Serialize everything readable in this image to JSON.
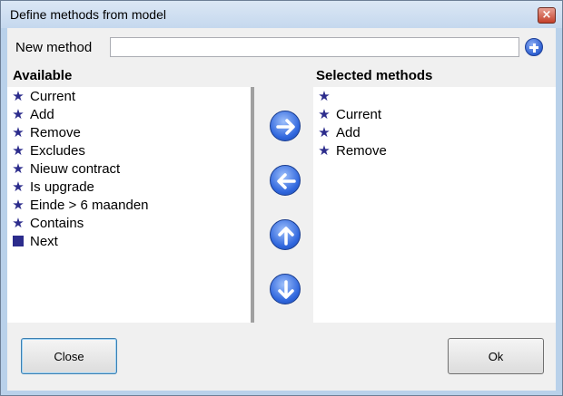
{
  "window": {
    "title": "Define methods from model",
    "close_glyph": "×"
  },
  "new_method": {
    "label": "New method",
    "value": "",
    "placeholder": ""
  },
  "available": {
    "header": "Available",
    "items": [
      {
        "label": "Current",
        "icon": "star-icon"
      },
      {
        "label": "Add",
        "icon": "star-icon"
      },
      {
        "label": "Remove",
        "icon": "star-icon"
      },
      {
        "label": "Excludes",
        "icon": "star-icon"
      },
      {
        "label": "Nieuw contract",
        "icon": "star-icon"
      },
      {
        "label": "Is upgrade",
        "icon": "star-icon"
      },
      {
        "label": "Einde > 6 maanden",
        "icon": "star-icon"
      },
      {
        "label": "Contains",
        "icon": "star-icon"
      },
      {
        "label": "Next",
        "icon": "square-icon"
      }
    ]
  },
  "selected": {
    "header": "Selected methods",
    "items": [
      {
        "label": "",
        "icon": "star-icon"
      },
      {
        "label": "Current",
        "icon": "star-icon"
      },
      {
        "label": "Add",
        "icon": "star-icon"
      },
      {
        "label": "Remove",
        "icon": "star-icon"
      }
    ]
  },
  "buttons": {
    "close": "Close",
    "ok": "Ok"
  },
  "colors": {
    "icon": "#2c2c8c",
    "arrow_button": "#2f66dd"
  }
}
